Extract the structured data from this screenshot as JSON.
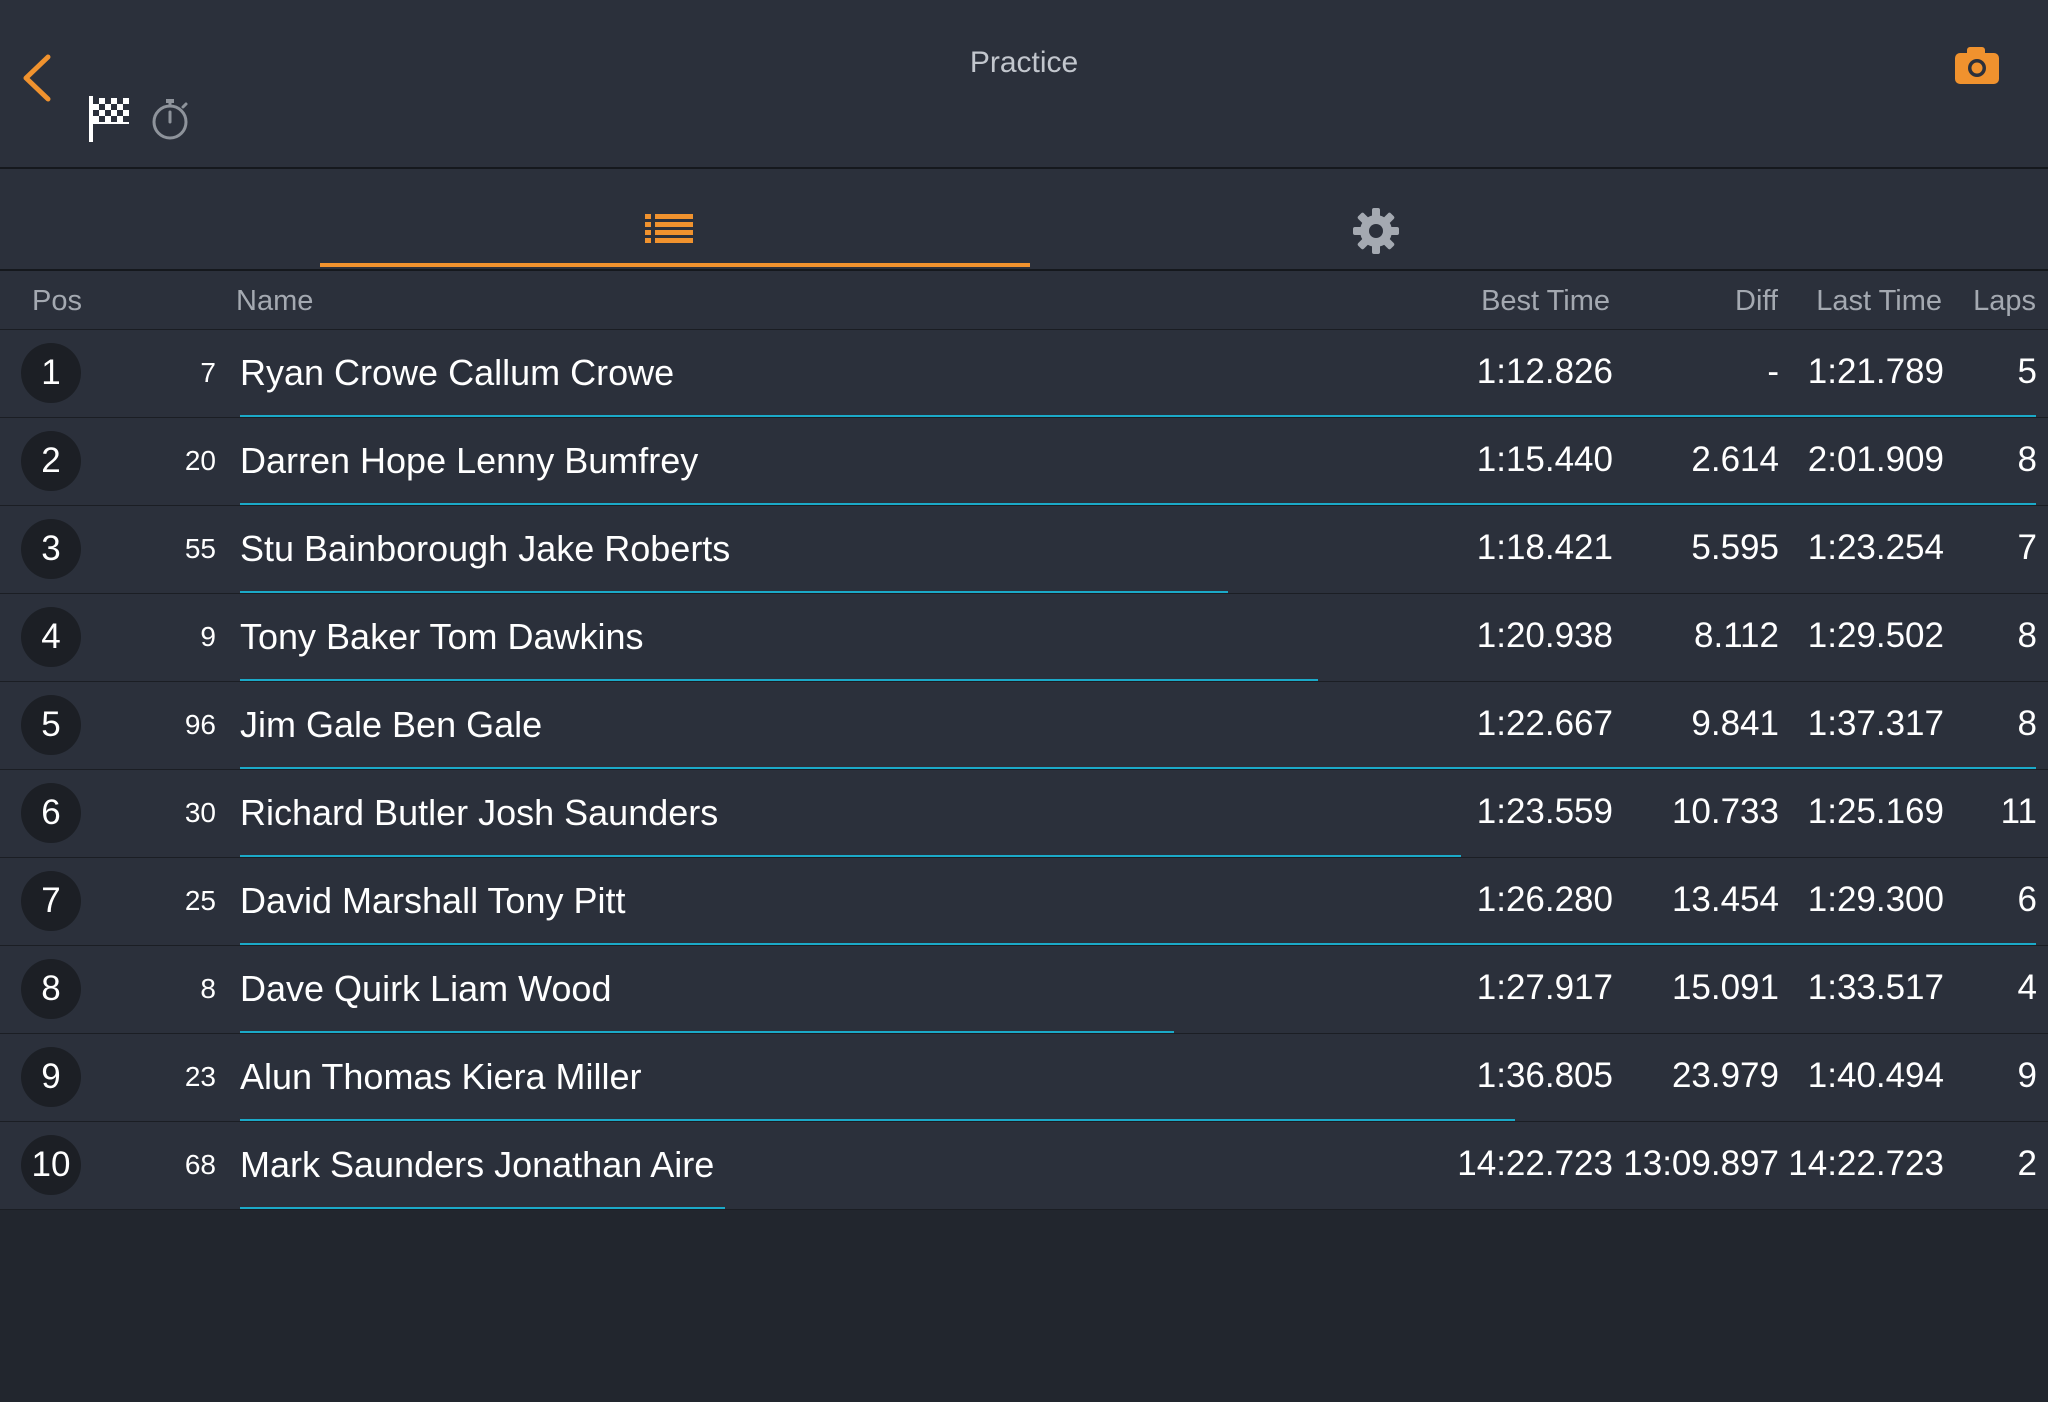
{
  "header": {
    "title": "Practice",
    "icons": [
      "back-chevron-icon",
      "checkered-flag-icon",
      "stopwatch-icon",
      "camera-icon"
    ]
  },
  "tabs": [
    {
      "icon": "list-icon",
      "active": true
    },
    {
      "icon": "gear-icon",
      "active": false
    }
  ],
  "colors": {
    "accent": "#f0922e",
    "progress": "#1ba9c8",
    "panel": "#2b303b",
    "background": "#22262e"
  },
  "table": {
    "columns": {
      "pos": "Pos",
      "name": "Name",
      "best": "Best Time",
      "diff": "Diff",
      "last": "Last Time",
      "laps": "Laps"
    },
    "rows": [
      {
        "pos": "1",
        "num": "7",
        "name": "Ryan Crowe Callum Crowe",
        "best": "1:12.826",
        "diff": "-",
        "last": "1:21.789",
        "laps": "5",
        "progress": 1.0
      },
      {
        "pos": "2",
        "num": "20",
        "name": "Darren Hope Lenny Bumfrey",
        "best": "1:15.440",
        "diff": "2.614",
        "last": "2:01.909",
        "laps": "8",
        "progress": 1.0
      },
      {
        "pos": "3",
        "num": "55",
        "name": "Stu Bainborough Jake Roberts",
        "best": "1:18.421",
        "diff": "5.595",
        "last": "1:23.254",
        "laps": "7",
        "progress": 0.55
      },
      {
        "pos": "4",
        "num": "9",
        "name": "Tony Baker Tom Dawkins",
        "best": "1:20.938",
        "diff": "8.112",
        "last": "1:29.502",
        "laps": "8",
        "progress": 0.6
      },
      {
        "pos": "5",
        "num": "96",
        "name": "Jim Gale Ben Gale",
        "best": "1:22.667",
        "diff": "9.841",
        "last": "1:37.317",
        "laps": "8",
        "progress": 1.0
      },
      {
        "pos": "6",
        "num": "30",
        "name": "Richard Butler Josh Saunders",
        "best": "1:23.559",
        "diff": "10.733",
        "last": "1:25.169",
        "laps": "11",
        "progress": 0.68
      },
      {
        "pos": "7",
        "num": "25",
        "name": "David Marshall Tony Pitt",
        "best": "1:26.280",
        "diff": "13.454",
        "last": "1:29.300",
        "laps": "6",
        "progress": 1.0
      },
      {
        "pos": "8",
        "num": "8",
        "name": "Dave Quirk Liam Wood",
        "best": "1:27.917",
        "diff": "15.091",
        "last": "1:33.517",
        "laps": "4",
        "progress": 0.52
      },
      {
        "pos": "9",
        "num": "23",
        "name": "Alun Thomas Kiera Miller",
        "best": "1:36.805",
        "diff": "23.979",
        "last": "1:40.494",
        "laps": "9",
        "progress": 0.71
      },
      {
        "pos": "10",
        "num": "68",
        "name": "Mark Saunders Jonathan Aire",
        "best": "14:22.723",
        "diff": "13:09.897",
        "last": "14:22.723",
        "laps": "2",
        "progress": 0.27
      }
    ]
  }
}
